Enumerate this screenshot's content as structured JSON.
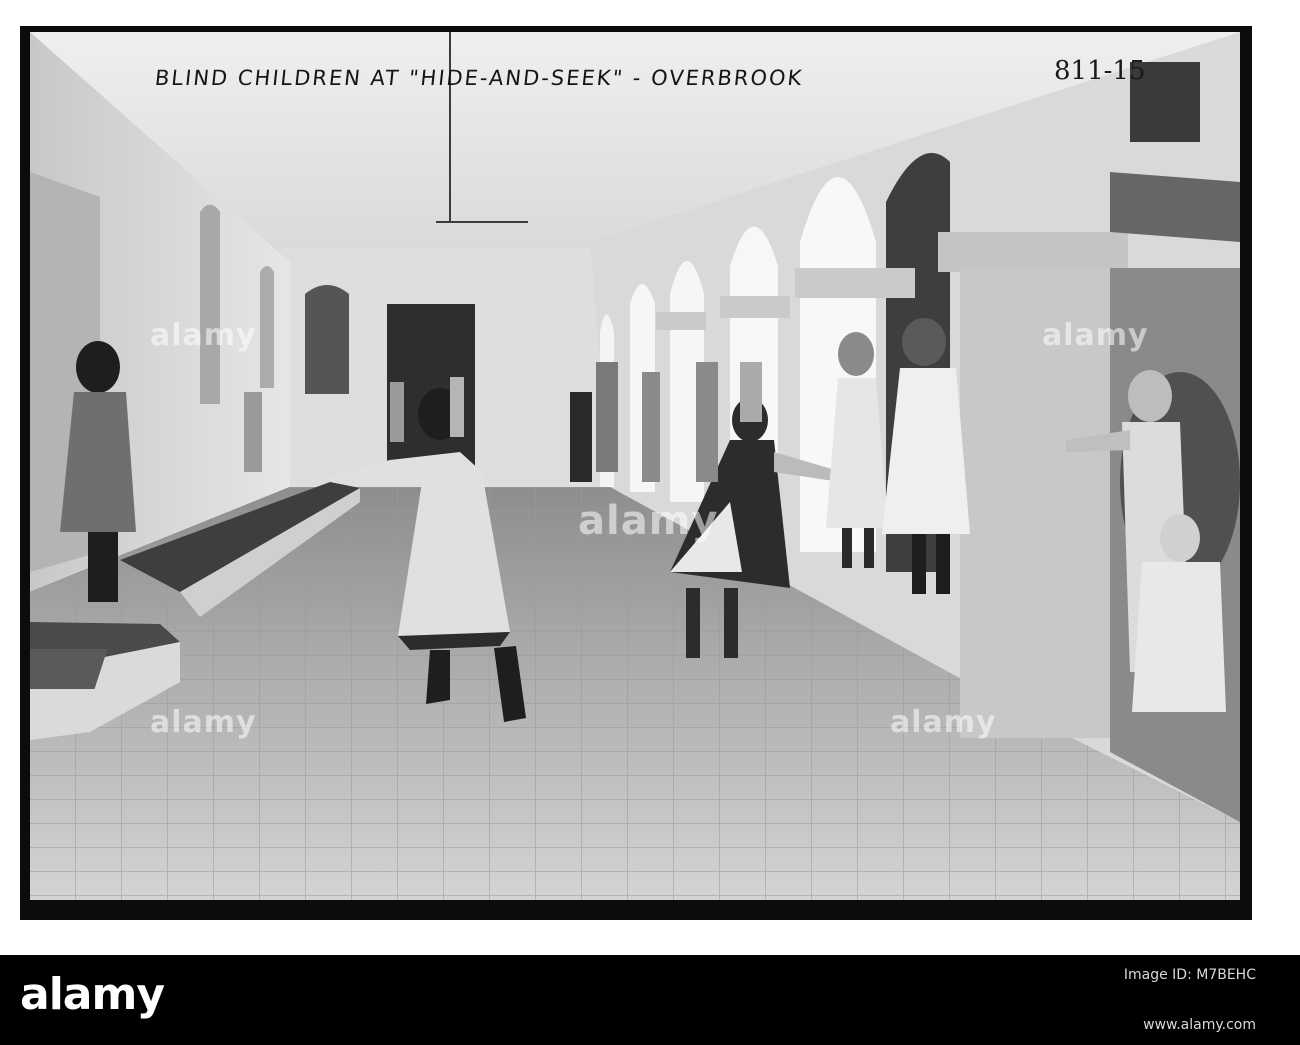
{
  "photo": {
    "caption": "BLIND CHILDREN AT \"HIDE-AND-SEEK\" - OVERBROOK",
    "plate_number": "811-15"
  },
  "watermark": {
    "text": "alamy"
  },
  "footer": {
    "brand": "alamy",
    "image_id_label": "Image ID: M7BEHC",
    "url": "www.alamy.com"
  }
}
